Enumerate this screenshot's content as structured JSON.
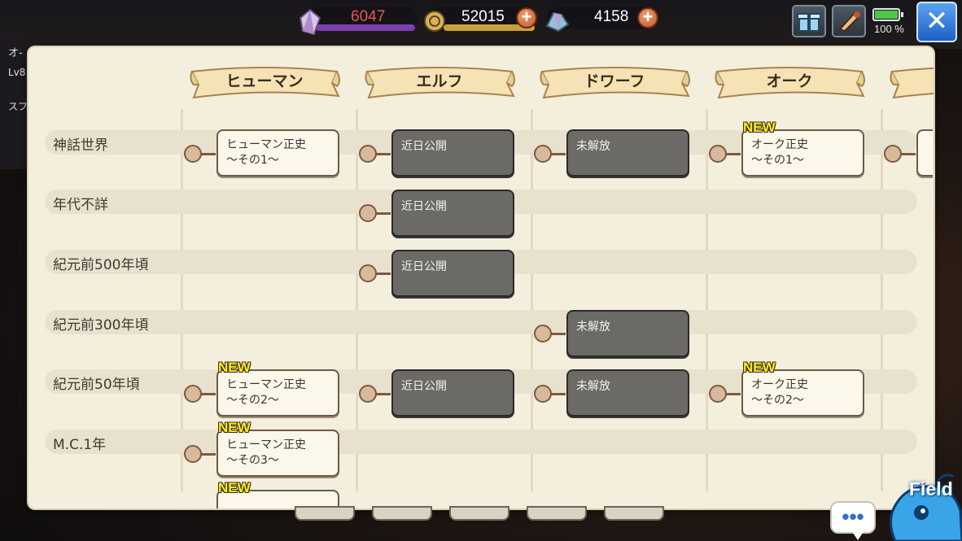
{
  "hud": {
    "stamina": "6047",
    "gold": "52015",
    "gems": "4158",
    "battery": "100 %",
    "plus_glyph": "+",
    "close_glyph": "✕"
  },
  "background": {
    "char_name_fragment": "オ-",
    "level_fragment": "Lv8",
    "menu_fragment": "スフ"
  },
  "races": [
    "ヒューマン",
    "エルフ",
    "ドワーフ",
    "オーク"
  ],
  "eras": [
    "神話世界",
    "年代不詳",
    "紀元前500年頃",
    "紀元前300年頃",
    "紀元前50年頃",
    "M.C.1年"
  ],
  "labels": {
    "new": "NEW",
    "human_1": "ヒューマン正史\n〜その1〜",
    "human_2": "ヒューマン正史\n〜その2〜",
    "human_3": "ヒューマン正史\n〜その3〜",
    "orc_1": "オーク正史\n〜その1〜",
    "orc_2": "オーク正史\n〜その2〜",
    "coming_soon": "近日公開",
    "locked": "未解放"
  },
  "bottom": {
    "chat_glyph": "•••",
    "field_label": "Field"
  },
  "colors": {
    "panel": "#f4efdd",
    "card_light": "#fbf7ea",
    "card_dark": "#6c6a66",
    "new_tag": "#ffef1a",
    "stamina_text": "#e2585a",
    "close_button": "#2f7fe0"
  }
}
